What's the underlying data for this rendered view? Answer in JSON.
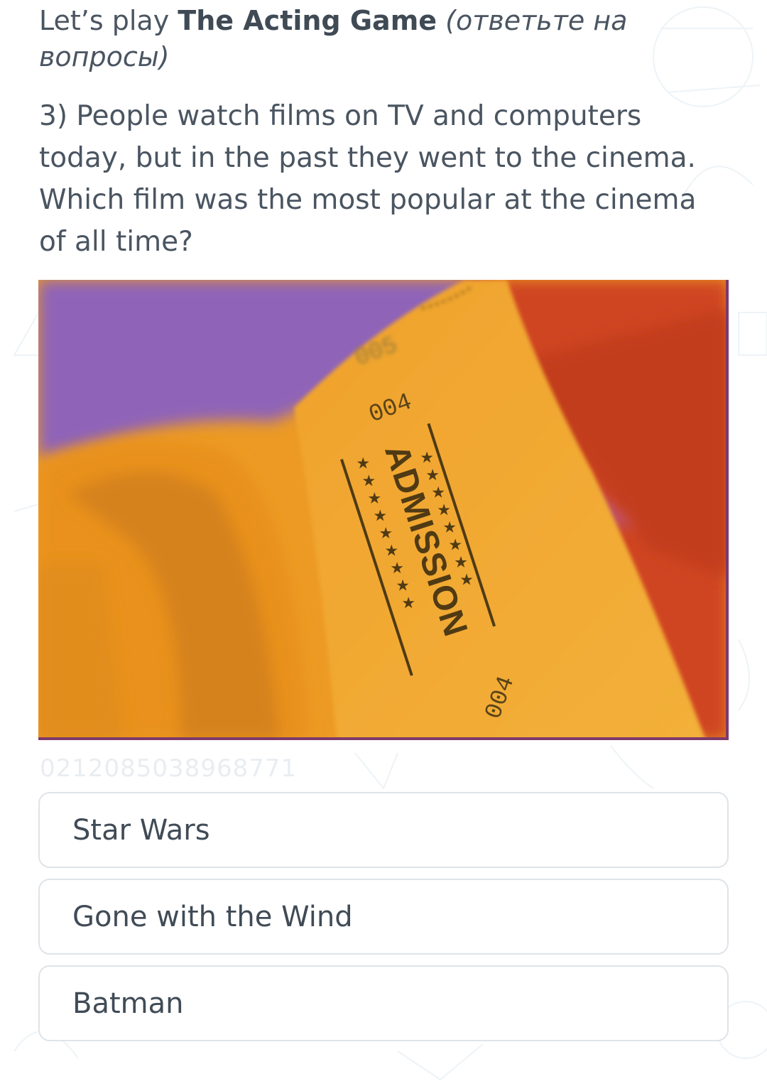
{
  "question_block": {
    "intro_prefix": "Let’s play ",
    "game_title": "The Acting Game",
    "instruction": "(ответьте на вопросы)",
    "question_text": "3) People watch films on TV and computers today, but in the past they went to the cinema. Which film was the most popular at the cinema of all time?"
  },
  "photo": {
    "ticket_word": "ADMISSION",
    "ticket_numbers": [
      "004",
      "004",
      "005"
    ],
    "watermark_code": "0212085038968771"
  },
  "options": [
    {
      "label": "Star Wars"
    },
    {
      "label": "Gone with the Wind"
    },
    {
      "label": "Batman"
    }
  ]
}
